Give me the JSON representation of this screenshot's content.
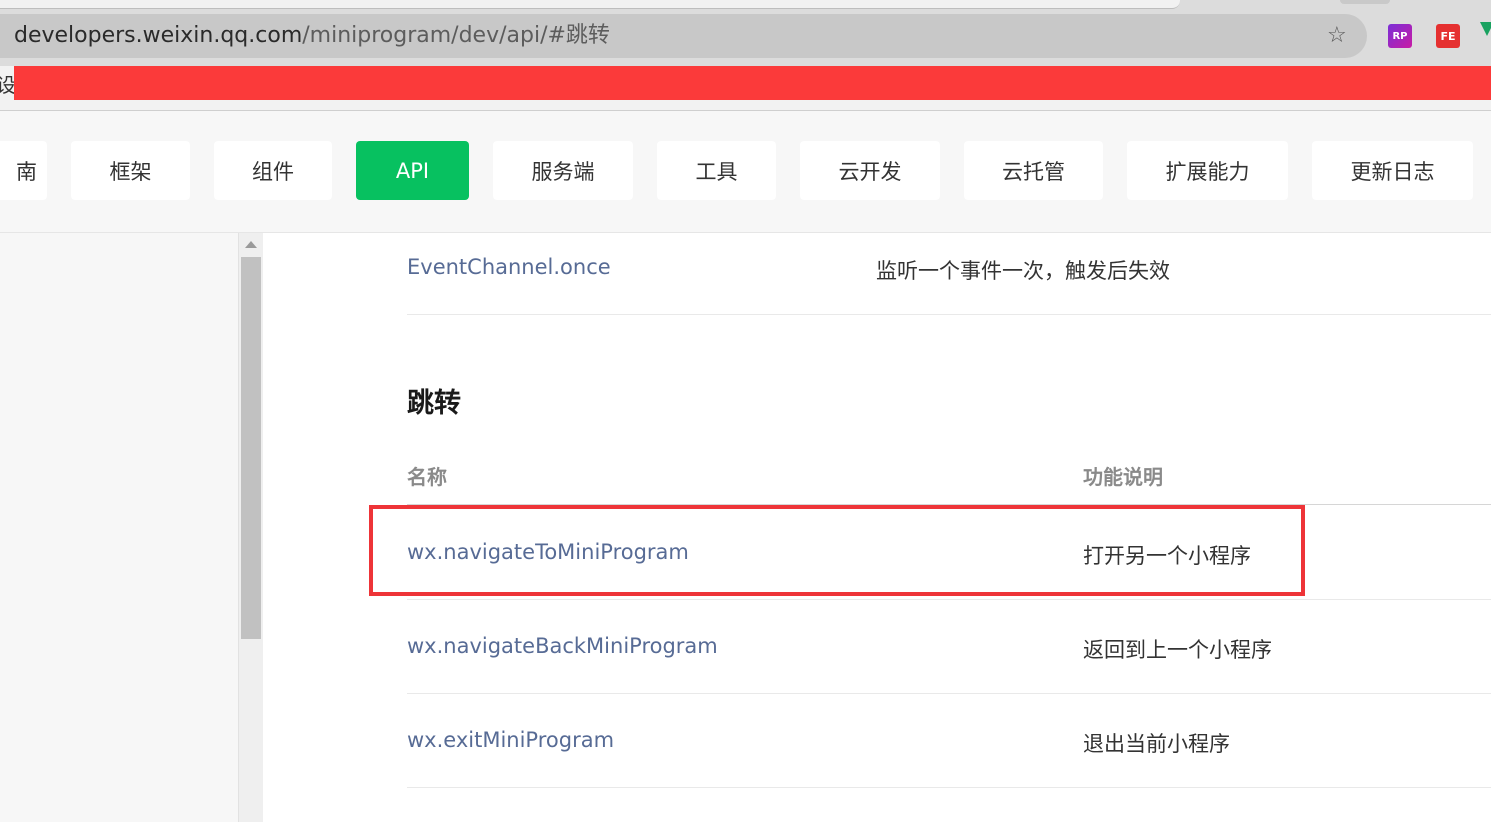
{
  "browser": {
    "url_host": "developers.weixin.qq.com",
    "url_path": "/miniprogram/dev/api/#跳转",
    "extensions": [
      {
        "name": "rp-extension-icon",
        "label": "RP"
      },
      {
        "name": "fe-extension-icon",
        "label": "FE"
      }
    ]
  },
  "bookmarks": {
    "partial_text": "设"
  },
  "nav": {
    "items": [
      {
        "label": "南"
      },
      {
        "label": "框架"
      },
      {
        "label": "组件"
      },
      {
        "label": "API"
      },
      {
        "label": "服务端"
      },
      {
        "label": "工具"
      },
      {
        "label": "云开发"
      },
      {
        "label": "云托管"
      },
      {
        "label": "扩展能力"
      },
      {
        "label": "更新日志"
      }
    ],
    "active": "API"
  },
  "content": {
    "prev_row": {
      "name": "EventChannel.once",
      "desc": "监听一个事件一次，触发后失效"
    },
    "section_title": "跳转",
    "table": {
      "headers": {
        "name": "名称",
        "desc": "功能说明"
      },
      "rows": [
        {
          "name": "wx.navigateToMiniProgram",
          "desc": "打开另一个小程序"
        },
        {
          "name": "wx.navigateBackMiniProgram",
          "desc": "返回到上一个小程序"
        },
        {
          "name": "wx.exitMiniProgram",
          "desc": "退出当前小程序"
        }
      ]
    }
  },
  "colors": {
    "accent": "#07c160",
    "link": "#576b95",
    "highlight": "#ee3438",
    "red_bar": "#fb3a3a"
  }
}
